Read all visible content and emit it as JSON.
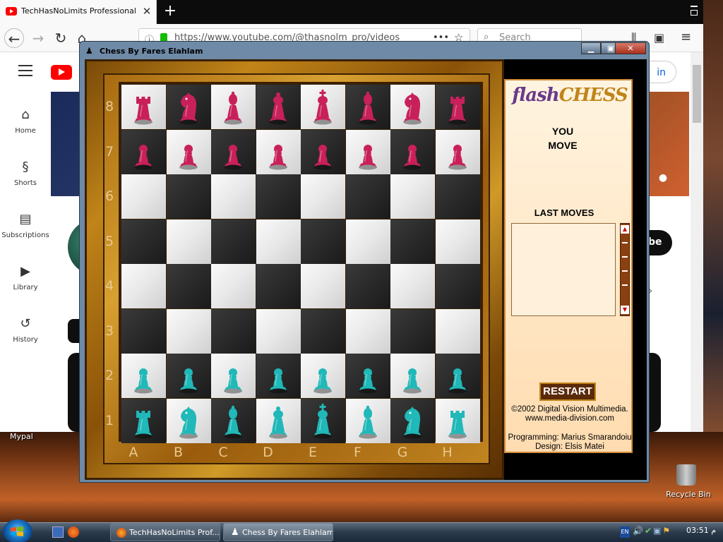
{
  "browser": {
    "tab_title": "TechHasNoLimits Professional - YouTube",
    "tab_close": "✕",
    "new_tab": "+",
    "url": "https://www.youtube.com/@thasnolm_pro/videos",
    "url_dots": "•••",
    "search_placeholder": "Search",
    "sidebar": [
      {
        "label": "Home",
        "icon": "⌂"
      },
      {
        "label": "Shorts",
        "icon": "§"
      },
      {
        "label": "Subscriptions",
        "icon": "▤"
      },
      {
        "label": "Library",
        "icon": "▶"
      },
      {
        "label": "History",
        "icon": "↺"
      }
    ],
    "signin": "in",
    "subscribe": "be"
  },
  "desktop": {
    "mypal_label": "Mypal",
    "recycle_label": "Recycle Bin"
  },
  "chess_window": {
    "title": "Chess By Fares Elahlam",
    "logo_flash": "flash",
    "logo_chess": "CHESS",
    "status_line1": "YOU",
    "status_line2": "MOVE",
    "last_moves_title": "LAST MOVES",
    "restart": "RESTART",
    "credit1": "©2002 Digital Vision Multimedia.",
    "credit2": "www.media-division.com",
    "credit3": "Programming: Marius Smarandoiu",
    "credit4": "Design: Elsis Matei",
    "ranks": [
      "8",
      "7",
      "6",
      "5",
      "4",
      "3",
      "2",
      "1"
    ],
    "files": [
      "A",
      "B",
      "C",
      "D",
      "E",
      "F",
      "G",
      "H"
    ],
    "colors": {
      "black_pieces": "#c8205a",
      "white_pieces": "#20b8b8",
      "wood": "#c08418"
    },
    "board": [
      [
        "r",
        "n",
        "b",
        "q",
        "k",
        "b",
        "n",
        "r"
      ],
      [
        "p",
        "p",
        "p",
        "p",
        "p",
        "p",
        "p",
        "p"
      ],
      [
        "",
        "",
        "",
        "",
        "",
        "",
        "",
        ""
      ],
      [
        "",
        "",
        "",
        "",
        "",
        "",
        "",
        ""
      ],
      [
        "",
        "",
        "",
        "",
        "",
        "",
        "",
        ""
      ],
      [
        "",
        "",
        "",
        "",
        "",
        "",
        "",
        ""
      ],
      [
        "P",
        "P",
        "P",
        "P",
        "P",
        "P",
        "P",
        "P"
      ],
      [
        "R",
        "N",
        "B",
        "Q",
        "K",
        "B",
        "N",
        "R"
      ]
    ]
  },
  "taskbar": {
    "items": [
      {
        "label": "TechHasNoLimits Prof...",
        "icon": "firefox-icon"
      },
      {
        "label": "Chess By Fares Elahlam",
        "icon": "chess-icon"
      }
    ],
    "lang": "EN",
    "clock": "03:51 م"
  }
}
